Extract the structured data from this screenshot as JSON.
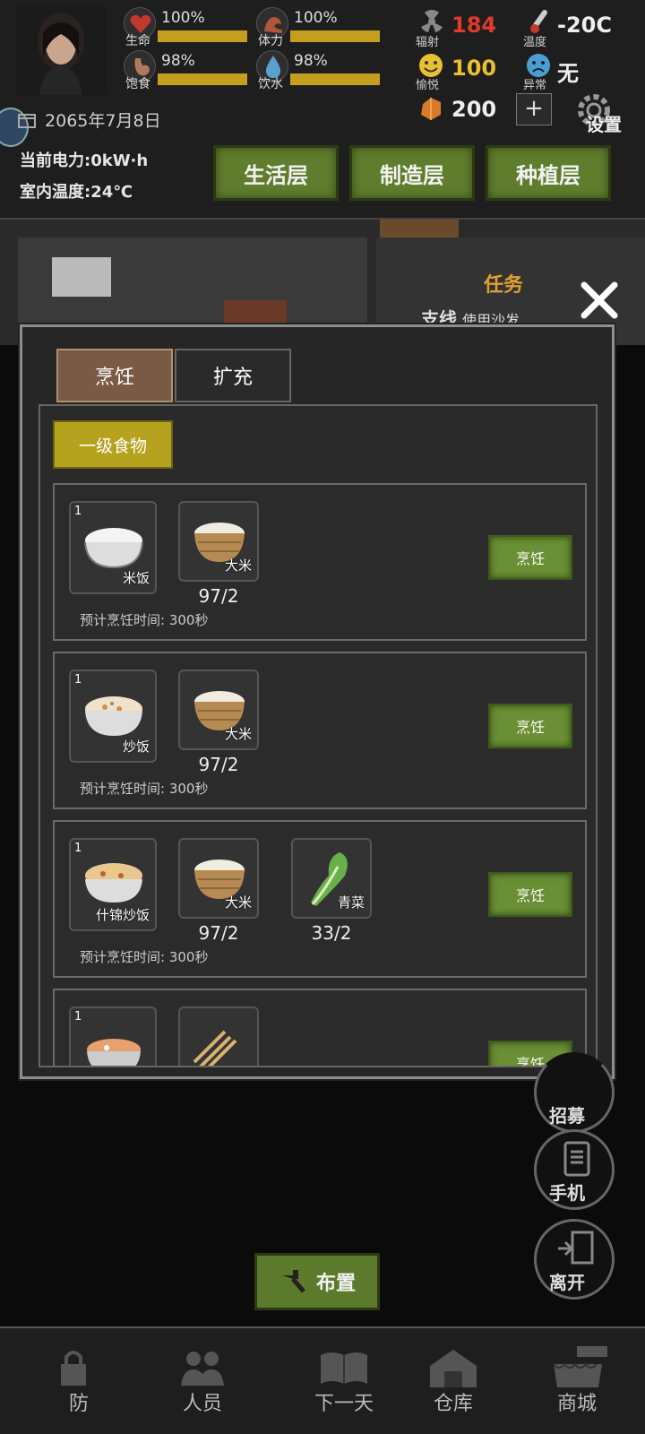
{
  "hud": {
    "stats": [
      {
        "name": "生命",
        "percent": "100%",
        "icon": "heart-icon",
        "color": "#c0392b"
      },
      {
        "name": "体力",
        "percent": "100%",
        "icon": "muscle-icon",
        "color": "#b0563a"
      },
      {
        "name": "饱食",
        "percent": "98%",
        "icon": "stomach-icon",
        "color": "#b07a5a"
      },
      {
        "name": "饮水",
        "percent": "98%",
        "icon": "water-drop-icon",
        "color": "#5aa0d0"
      }
    ],
    "radiation": {
      "label": "辐射",
      "value": "184",
      "color": "#e03a2a"
    },
    "mood": {
      "label": "愉悦",
      "value": "100",
      "color": "#e8c030"
    },
    "currency": {
      "value": "200"
    },
    "temperature": {
      "label": "温度",
      "value": "-20C"
    },
    "abnormal": {
      "label": "异常",
      "value": "无"
    },
    "plus_label": "+",
    "settings_label": "设置",
    "date": "2065年7月8日",
    "power": "当前电力:0kW·h",
    "indoor_temp": "室内温度:24℃",
    "layers": [
      "生活层",
      "制造层",
      "种植层"
    ]
  },
  "scene": {
    "task_label": "任务",
    "branch_label": "支线",
    "branch_text": "使用沙发"
  },
  "modal": {
    "tabs": [
      "烹饪",
      "扩充"
    ],
    "level_label": "一级食物",
    "recipes": [
      {
        "result": {
          "count": "1",
          "name": "米饭"
        },
        "ingredients": [
          {
            "name": "大米",
            "qty": "97/2"
          }
        ],
        "eta": "预计烹饪时间: 300秒",
        "button": "烹饪"
      },
      {
        "result": {
          "count": "1",
          "name": "炒饭"
        },
        "ingredients": [
          {
            "name": "大米",
            "qty": "97/2"
          }
        ],
        "eta": "预计烹饪时间: 300秒",
        "button": "烹饪"
      },
      {
        "result": {
          "count": "1",
          "name": "什锦炒饭"
        },
        "ingredients": [
          {
            "name": "大米",
            "qty": "97/2"
          },
          {
            "name": "青菜",
            "qty": "33/2"
          }
        ],
        "eta": "预计烹饪时间: 300秒",
        "button": "烹饪"
      },
      {
        "result": {
          "count": "1",
          "name": ""
        },
        "ingredients": [
          {
            "name": "",
            "qty": ""
          }
        ],
        "eta": "",
        "button": "烹饪"
      }
    ]
  },
  "side_buttons": [
    "招募",
    "手机",
    "离开"
  ],
  "arrange_label": "布置",
  "nav": [
    "防",
    "人员",
    "下一天",
    "仓库",
    "商城"
  ]
}
